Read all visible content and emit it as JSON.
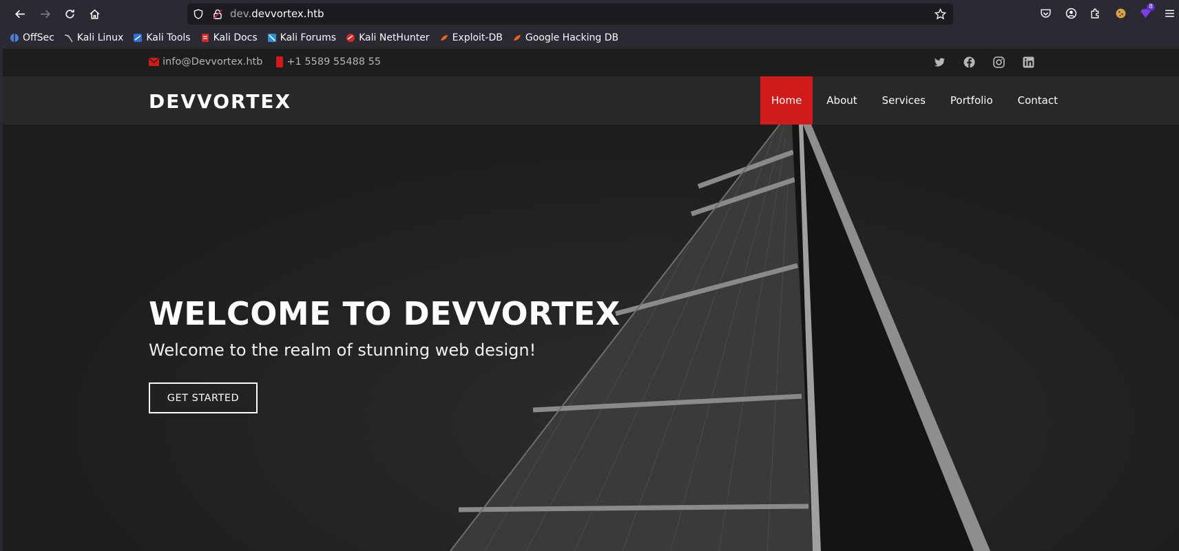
{
  "browser": {
    "url_prefix": "dev.",
    "url_domain": "devvortex.htb",
    "extensions_badge": "8",
    "bookmarks": [
      {
        "label": "OffSec",
        "icon": "offsec-icon",
        "color": "#4a7fd8"
      },
      {
        "label": "Kali Linux",
        "icon": "kali-dragon-icon",
        "color": "#cccccc"
      },
      {
        "label": "Kali Tools",
        "icon": "kali-tools-icon",
        "color": "#2f6fd6"
      },
      {
        "label": "Kali Docs",
        "icon": "kali-docs-icon",
        "color": "#d62828"
      },
      {
        "label": "Kali Forums",
        "icon": "kali-forums-icon",
        "color": "#2f8fd6"
      },
      {
        "label": "Kali NetHunter",
        "icon": "nethunter-icon",
        "color": "#d62828"
      },
      {
        "label": "Exploit-DB",
        "icon": "exploit-db-icon",
        "color": "#e8651f"
      },
      {
        "label": "Google Hacking DB",
        "icon": "ghdb-icon",
        "color": "#e8651f"
      }
    ]
  },
  "topbar": {
    "email": "info@Devvortex.htb",
    "phone": "+1 5589 55488 55",
    "accent_color": "#d11a1a",
    "social": [
      "twitter-icon",
      "facebook-icon",
      "instagram-icon",
      "linkedin-icon"
    ]
  },
  "header": {
    "logo": "DEVVORTEX",
    "nav": [
      "Home",
      "About",
      "Services",
      "Portfolio",
      "Contact"
    ],
    "active": "Home"
  },
  "hero": {
    "title": "WELCOME TO DEVVORTEX",
    "subtitle": "Welcome to the realm of stunning web design!",
    "cta": "GET STARTED"
  }
}
